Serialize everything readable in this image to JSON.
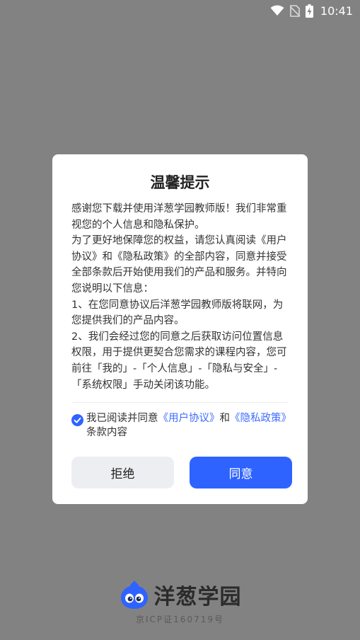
{
  "status_bar": {
    "time": "10:41",
    "icons": [
      "wifi-icon",
      "no-sim-icon",
      "battery-charging-icon"
    ]
  },
  "dialog": {
    "title": "温馨提示",
    "body": {
      "p1": "感谢您下载并使用洋葱学园教师版！我们非常重视您的个人信息和隐私保护。",
      "p2": "为了更好地保障您的权益，请您认真阅读《用户协议》和《隐私政策》的全部内容，同意并接受全部条款后开始使用我们的产品和服务。并特向您说明以下信息：",
      "p3": " 1、在您同意协议后洋葱学园教师版将联网，为您提供我们的产品内容。",
      "p4": " 2、我们会经过您的同意之后获取访问位置信息权限，用于提供更契合您需求的课程内容，您可前往「我的」-「个人信息」-「隐私与安全」-「系统权限」手动关闭该功能。"
    },
    "agreement": {
      "checked": true,
      "prefix": "我已阅读并同意",
      "user_agreement_link": "《用户协议》",
      "conjunction": "和",
      "privacy_policy_link": "《隐私政策》",
      "suffix": "条款内容"
    },
    "buttons": {
      "reject_label": "拒绝",
      "accept_label": "同意"
    }
  },
  "footer": {
    "brand_name": "洋葱学园",
    "icp": "京ICP证160719号"
  },
  "colors": {
    "overlay": "#828282",
    "accent": "#2f63ff",
    "link": "#3d6bff",
    "reject_bg": "#eceef1",
    "mascot": "#2f63ff"
  }
}
